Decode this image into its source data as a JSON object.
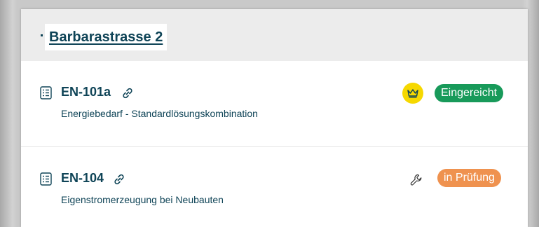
{
  "address": "Barbarastrasse 2",
  "items": [
    {
      "code": "EN-101a",
      "description": "Energiebedarf - Standardlösungskombination",
      "status": "Eingereicht",
      "status_color": "#189a5a",
      "extra_icon": "crown-icon",
      "extra_icon_bg": "#f6d800"
    },
    {
      "code": "EN-104",
      "description": "Eigenstromerzeugung bei Neubauten",
      "status": "in Prüfung",
      "status_color": "#ef924f",
      "extra_icon": "wrench-icon"
    }
  ],
  "colors": {
    "text": "#0f4457",
    "header_bg": "#ececec"
  }
}
